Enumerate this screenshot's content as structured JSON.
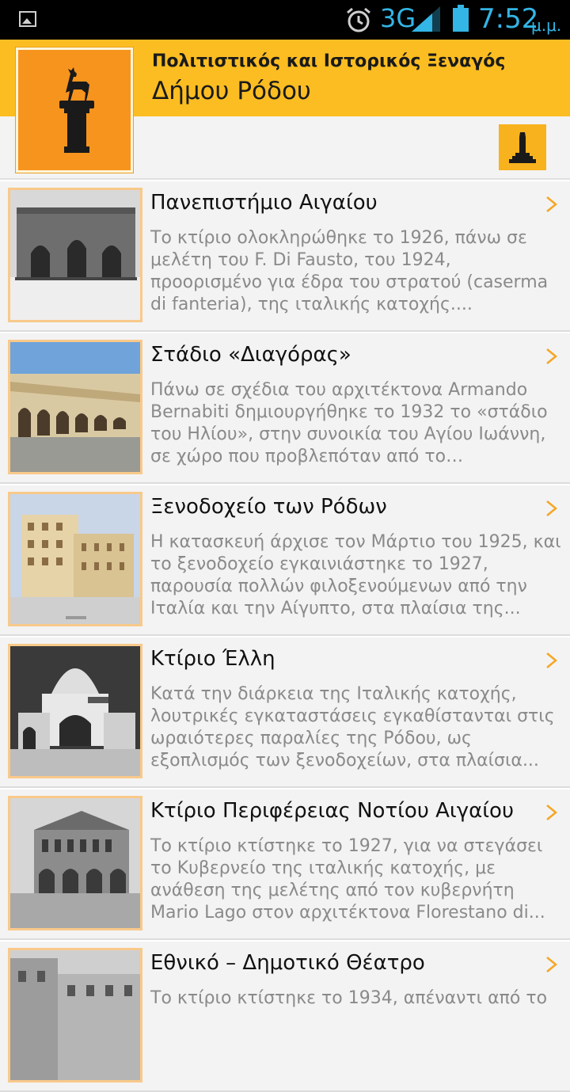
{
  "status_bar": {
    "network": "3G",
    "time": "7:52",
    "ampm": "μ.μ."
  },
  "header": {
    "line1": "Πολιτιστικός και Ιστορικός Ξεναγός",
    "line2": "Δήμου Ρόδου"
  },
  "items": [
    {
      "title": "Πανεπιστήμιο Αιγαίου",
      "description": "Το κτίριο ολοκληρώθηκε το 1926, πάνω σε μελέτη του F. Di Fausto, του 1924, προορισμένο για έδρα του στρατού (caserma di fanteria), της ιταλικής κατοχής...."
    },
    {
      "title": "Στάδιο «Διαγόρας»",
      "description": "Πάνω σε σχέδια του αρχιτέκτονα Armando Bernabiti δημιουργήθηκε το 1932 το «στάδιο του Ηλίου», στην συνοικία του Αγίου Ιωάννη, σε χώρο που προβλεπόταν από το Ρυθμιστικό..."
    },
    {
      "title": "Ξενοδοχείο των Ρόδων",
      "description": "Η κατασκευή άρχισε τον Μάρτιο του 1925, και το ξενοδοχείο εγκαινιάστηκε το 1927, παρουσία πολλών φιλοξενούμενων από την Ιταλία και την Αίγυπτο, στα πλαίσια της..."
    },
    {
      "title": "Κτίριο Έλλη",
      "description": "Κατά την διάρκεια της Ιταλικής κατοχής, λουτρικές εγκαταστάσεις εγκαθίστανται στις ωραιότερες παραλίες της Ρόδου, ως εξοπλισμός των ξενοδοχείων, στα πλαίσια..."
    },
    {
      "title": "Κτίριο Περιφέρειας Νοτίου Αιγαίου",
      "description": "Το κτίριο κτίστηκε το 1927, για να στεγάσει το Κυβερνείο της ιταλικής κατοχής, με ανάθεση της μελέτης από τον κυβερνήτη Mario Lago στον αρχιτέκτονα Florestano di..."
    },
    {
      "title": "Εθνικό – Δημοτικό Θέατρο",
      "description": "Το κτίριο κτίστηκε το 1934, απέναντι από το"
    }
  ],
  "colors": {
    "accent": "#fbbd21",
    "logo_bg": "#f7941d",
    "thumb_border": "#f9c98a",
    "chevron": "#f6a623"
  }
}
